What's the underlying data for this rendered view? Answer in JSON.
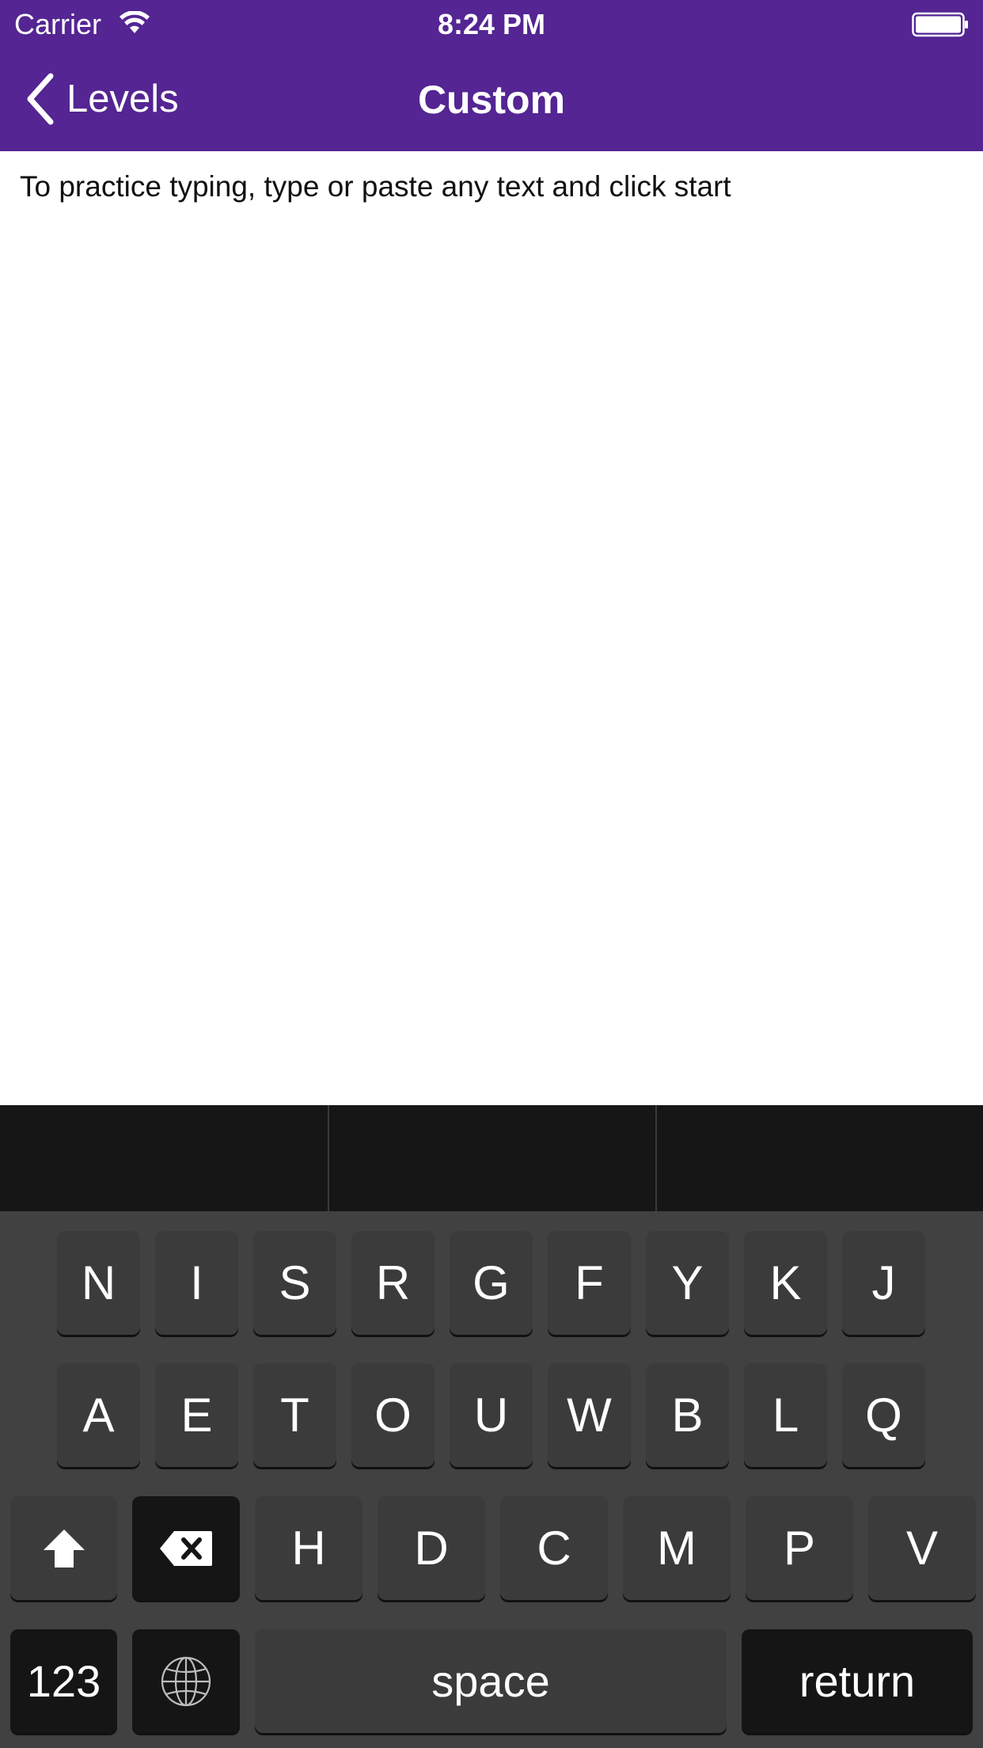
{
  "status_bar": {
    "carrier": "Carrier",
    "time": "8:24 PM"
  },
  "nav": {
    "back_label": "Levels",
    "title": "Custom"
  },
  "content": {
    "instruction": "To practice typing, type or paste any text and click start"
  },
  "keyboard": {
    "row1": [
      "N",
      "I",
      "S",
      "R",
      "G",
      "F",
      "Y",
      "K",
      "J"
    ],
    "row2": [
      "A",
      "E",
      "T",
      "O",
      "U",
      "W",
      "B",
      "L",
      "Q"
    ],
    "row3": [
      "H",
      "D",
      "C",
      "M",
      "P",
      "V"
    ],
    "numbers_label": "123",
    "space_label": "space",
    "return_label": "return"
  },
  "colors": {
    "header": "#542593",
    "keyboard_bg": "#414141",
    "key": "#3b3b3b",
    "key_dark": "#151515"
  }
}
